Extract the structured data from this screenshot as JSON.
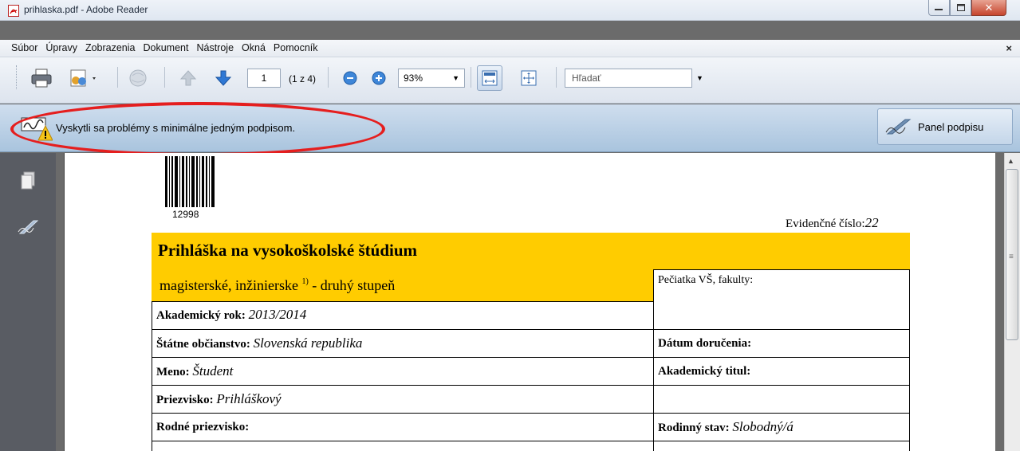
{
  "window": {
    "title": "prihlaska.pdf - Adobe Reader"
  },
  "menu": {
    "items": [
      "Súbor",
      "Úpravy",
      "Zobrazenia",
      "Dokument",
      "Nástroje",
      "Okná",
      "Pomocník"
    ],
    "close": "×"
  },
  "toolbar": {
    "page_current": "1",
    "page_count": "(1 z 4)",
    "zoom": "93%",
    "search_placeholder": "Hľadať"
  },
  "message": {
    "text": "Vyskytli sa problémy s minimálne jedným podpisom.",
    "panel_button": "Panel podpisu"
  },
  "document": {
    "barcode_number": "12998",
    "evid_label": "Evidenčné číslo:",
    "evid_value": "22",
    "title": "Prihláška na vysokoškolské štúdium",
    "subtitle": "magisterské, inžinierske",
    "subtitle_sup": "1)",
    "subtitle_tail": " - druhý stupeň",
    "rows": {
      "academic_year_label": "Akademický rok:",
      "academic_year_value": "2013/2014",
      "citizenship_label": "Štátne občianstvo:",
      "citizenship_value": "Slovenská republika",
      "name_label": "Meno:",
      "name_value": "Študent",
      "surname_label": "Priezvisko:",
      "surname_value": "Prihláškový",
      "birth_surname_label": "Rodné priezvisko:",
      "stamp_label": "Pečiatka VŠ, fakulty:",
      "delivery_label": "Dátum doručenia:",
      "degree_label": "Akademický titul:",
      "marital_label": "Rodinný stav:",
      "marital_value": "Slobodný/á"
    }
  }
}
